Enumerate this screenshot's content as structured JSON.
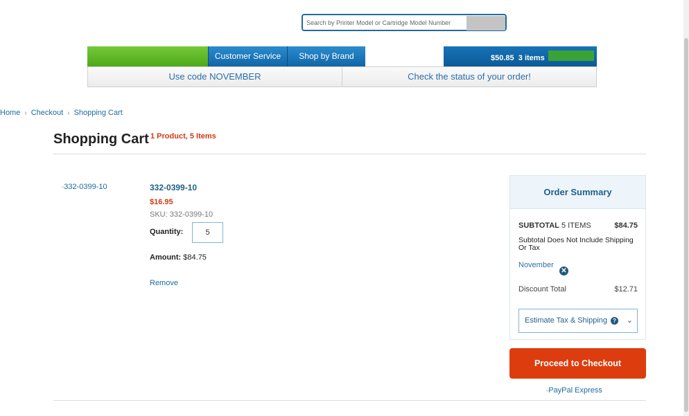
{
  "header": {
    "search": {
      "placeholder": "Search by Printer Model or Cartridge Model Number"
    },
    "nav": {
      "tabs": [
        {
          "label": "Customer Service"
        },
        {
          "label": "Shop by Brand"
        }
      ],
      "cart": {
        "total": "$50.85",
        "items": "3 items"
      }
    },
    "promo": {
      "left": "Use code NOVEMBER",
      "right": "Check the status of your order!"
    }
  },
  "breadcrumb": [
    {
      "label": "Home"
    },
    {
      "label": "Checkout"
    },
    {
      "label": "Shopping Cart"
    }
  ],
  "page": {
    "title": "Shopping Cart",
    "count": "1 Product, 5 Items"
  },
  "cart_item": {
    "image_alt": "332-0399-10",
    "name": "332-0399-10",
    "price": "$16.95",
    "sku": "SKU: 332-0399-10",
    "quantity_label": "Quantity:",
    "quantity": "5",
    "amount_label": "Amount:",
    "amount": "$84.75",
    "remove": "Remove"
  },
  "summary": {
    "title": "Order Summary",
    "subtotal_label": "SUBTOTAL",
    "subtotal_items": "5 ITEMS",
    "subtotal": "$84.75",
    "note": "Subtotal Does Not Include Shipping Or Tax",
    "coupon": "November",
    "discount_label": "Discount Total",
    "discount": "$12.71",
    "estimate_label": "Estimate Tax & Shipping",
    "checkout": "Proceed to Checkout",
    "paypal_alt": "PayPal Express"
  },
  "colors": {
    "accent": "#1f6b9e",
    "checkout": "#dd3d0e",
    "sale": "#cf3a12",
    "nav_green": "#5cb82a"
  },
  "icons": [
    "close-circle-icon",
    "question-circle-icon",
    "chevron-down-icon",
    "chevron-right-icon"
  ]
}
